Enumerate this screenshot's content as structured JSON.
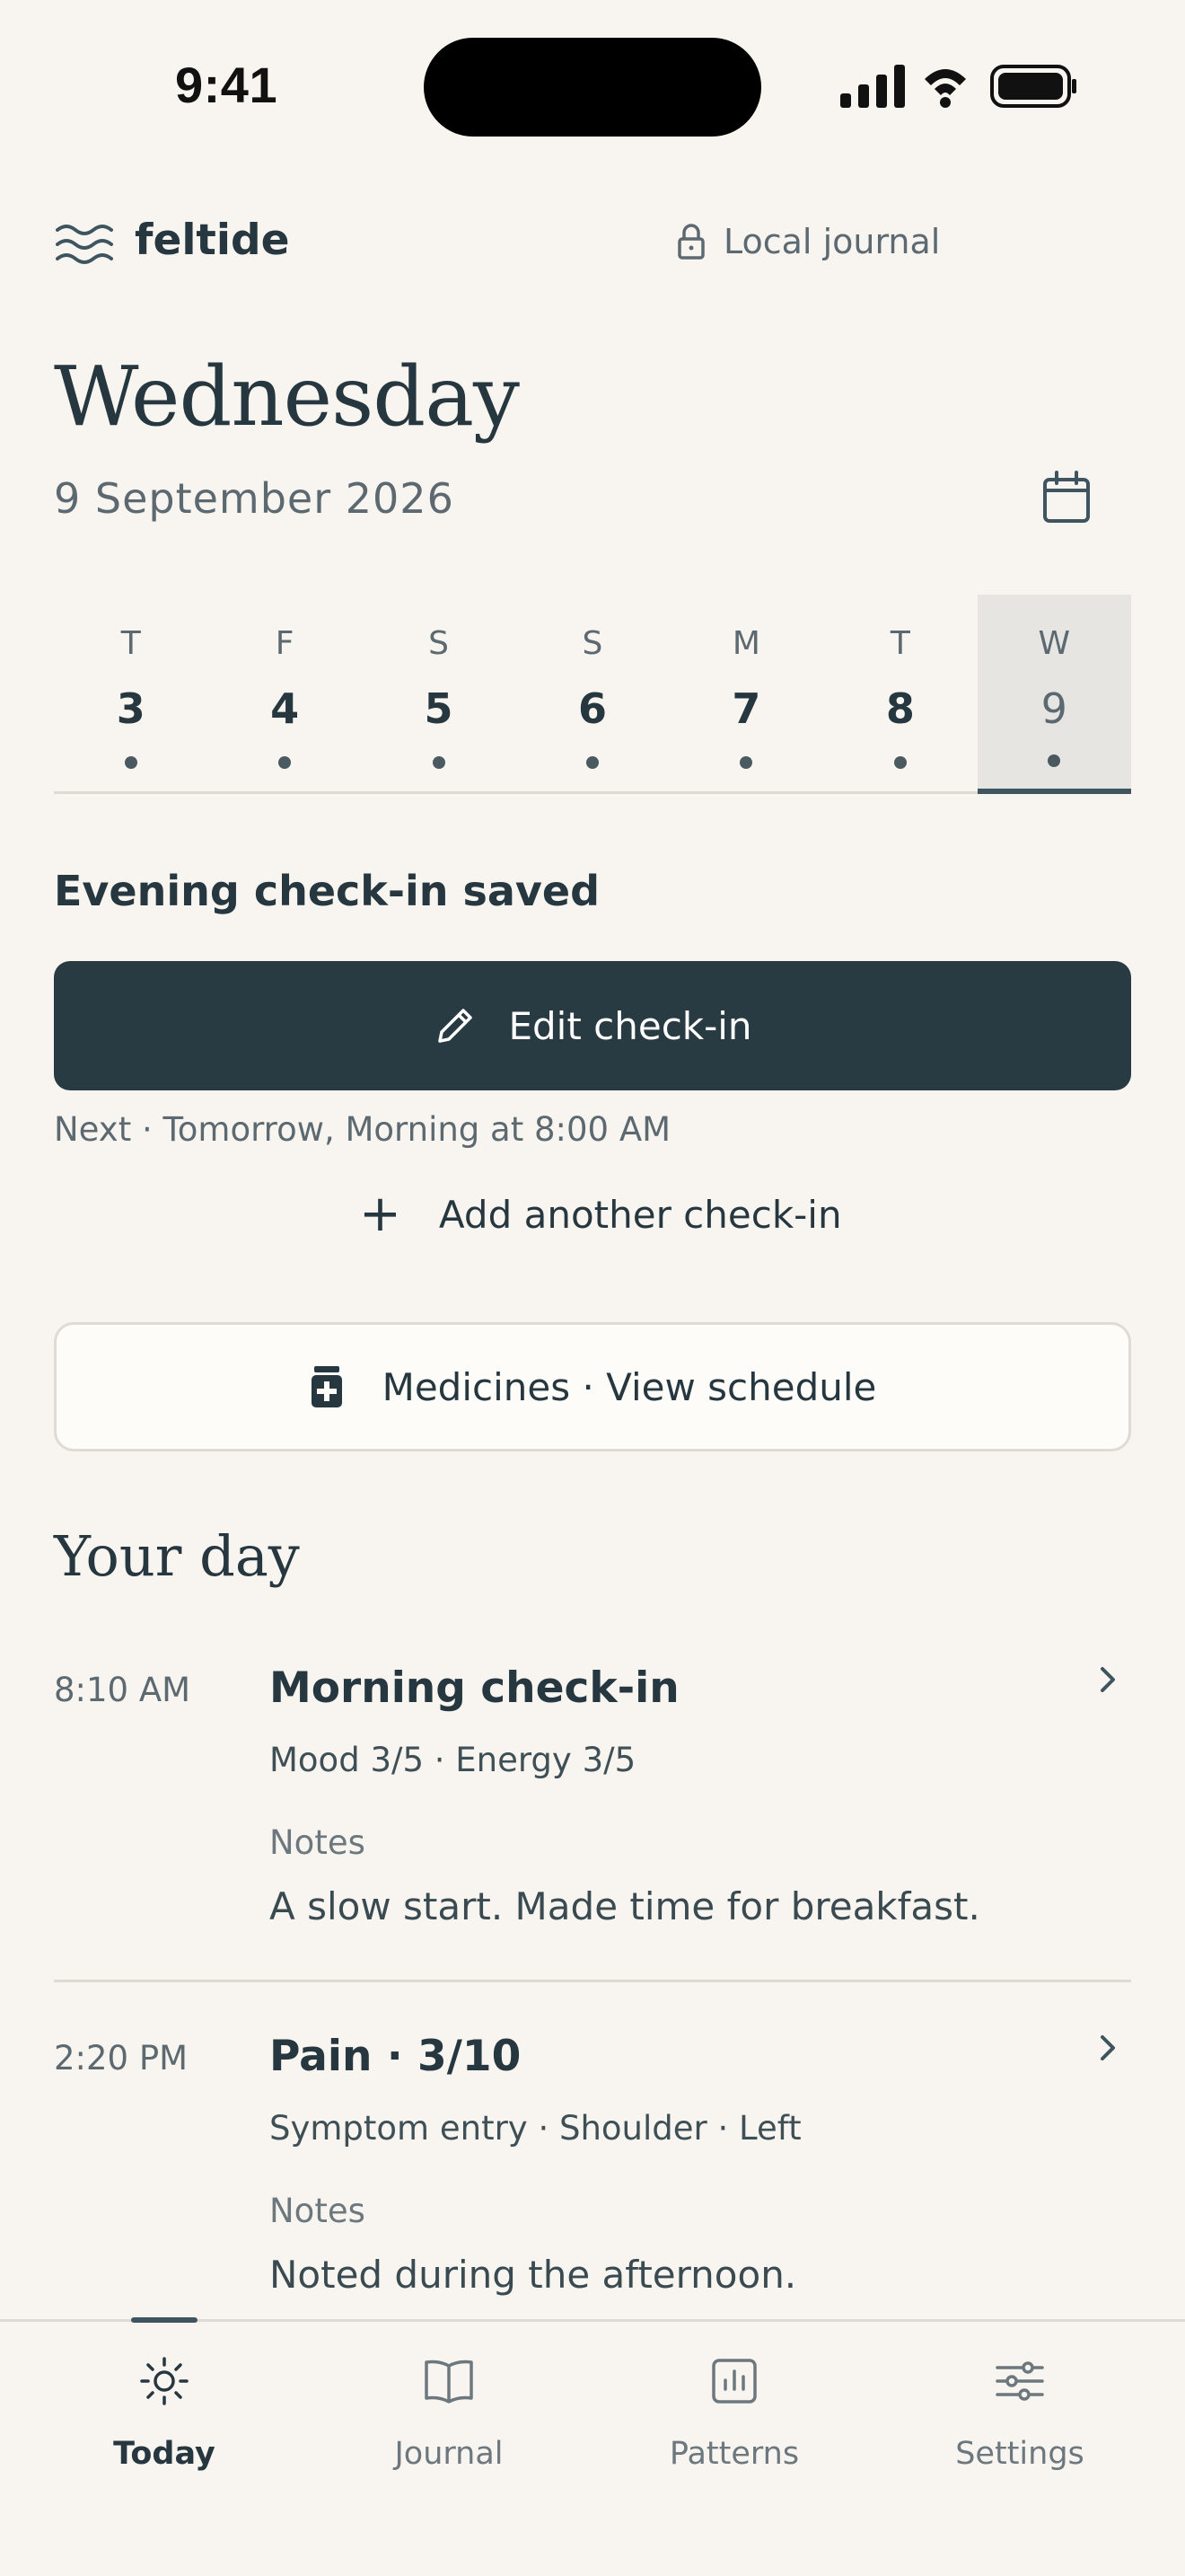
{
  "status_bar": {
    "time": "9:41"
  },
  "header": {
    "brand": "feltide",
    "privacy_label": "Local journal"
  },
  "date_header": {
    "weekday": "Wednesday",
    "date": "9 September 2026"
  },
  "week": [
    {
      "dow": "T",
      "num": "3"
    },
    {
      "dow": "F",
      "num": "4"
    },
    {
      "dow": "S",
      "num": "5"
    },
    {
      "dow": "S",
      "num": "6"
    },
    {
      "dow": "M",
      "num": "7"
    },
    {
      "dow": "T",
      "num": "8"
    },
    {
      "dow": "W",
      "num": "9"
    }
  ],
  "checkin": {
    "status_title": "Evening check-in saved",
    "edit_label": "Edit check-in",
    "next_text": "Next · Tomorrow, Morning at 8:00 AM",
    "add_label": "Add another check-in"
  },
  "medicines": {
    "label": "Medicines · View schedule"
  },
  "your_day": {
    "title": "Your day",
    "entries": [
      {
        "time": "8:10 AM",
        "title": "Morning check-in",
        "meta": "Mood 3/5 · Energy 3/5",
        "notes_label": "Notes",
        "notes": "A slow start. Made time for breakfast."
      },
      {
        "time": "2:20 PM",
        "title": "Pain · 3/10",
        "meta": "Symptom entry · Shoulder · Left",
        "notes_label": "Notes",
        "notes": "Noted during the afternoon."
      }
    ]
  },
  "tabs": [
    {
      "label": "Today",
      "icon": "sun-icon"
    },
    {
      "label": "Journal",
      "icon": "book-icon"
    },
    {
      "label": "Patterns",
      "icon": "chart-icon"
    },
    {
      "label": "Settings",
      "icon": "sliders-icon"
    }
  ],
  "colors": {
    "background": "#f8f5f0",
    "primary": "#283a42",
    "muted": "#5c6970"
  }
}
